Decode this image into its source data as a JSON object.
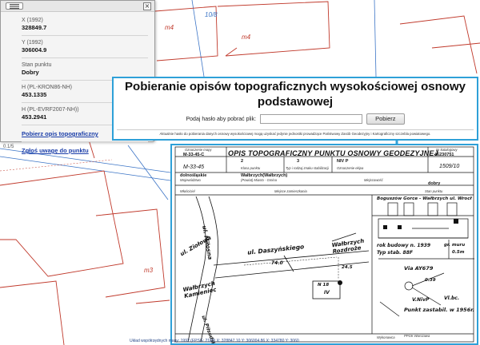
{
  "map": {
    "parcel_labels": [
      "m4",
      "m4",
      "m3",
      "10/8"
    ],
    "colors": {
      "parcel_red": "#c0392b",
      "road_blue": "#3b74c6",
      "accent_arrow": "#2ea0d8"
    }
  },
  "popup": {
    "collapse_icon": "list-icon",
    "close_label": "×",
    "fields": [
      {
        "label": "X (1992)",
        "value": "328849.7"
      },
      {
        "label": "Y (1992)",
        "value": "306004.9"
      },
      {
        "label": "Stan punktu",
        "value": "Dobry"
      },
      {
        "label": "H (PL-KRON86-NH)",
        "value": "453.1335"
      },
      {
        "label": "H (PL-EVRF2007-NH))",
        "value": "453.2941"
      }
    ],
    "links": {
      "download_description": "Pobierz opis topograficzny",
      "report_issue": "Zgłoś uwagę do punktu"
    },
    "scale_hint": "0.1/5"
  },
  "dialog": {
    "title": "Pobieranie opisów topograficznych wysokościowej osnowy podstawowej",
    "password_label": "Podaj hasło aby pobrać plik:",
    "password_value": "",
    "download_button": "Pobierz",
    "footnote": "Aktualnie hasło do pobierania danych osnowy wysokościowej mogą uzyskać jedynie jednostki prowadzące Państwowy Zasób Geodezyjny i Kartograficzny szczebla powiatowego."
  },
  "document": {
    "title": "OPIS TOPOGRAFICZNY PUNKTU OSNOWY GEODEZYJNEJ",
    "header": {
      "map_sheet_label": "Oznaczenie mapy",
      "map_sheet": "M-33-45-C",
      "map_sheet_2": "M-33-45",
      "class_label": "Klasa punktu",
      "class": "2",
      "stab_label": "Typ i rodzaj znaku stabilizacji",
      "stab": "3",
      "symbol_label": "Oznaczenie ekipa",
      "symbol": "NIV P",
      "catalog_label": "Nr katalogowy",
      "catalog": "46230751",
      "number": "1509/10",
      "voivodeship_label": "Województwo",
      "voivodeship": "dolnośląskie",
      "district_label": "(Powiat) Miasto - Gmina",
      "district": "Wałbrzych(Wałbrzych)",
      "locality_label": "Miejscowość",
      "state_label": "Stan punktu",
      "state": "dobry",
      "place_label": "Miejsce zamieszkania",
      "owner_label": "Właściciel"
    },
    "sketch": {
      "streets": [
        "ul. Ziołowa",
        "ul. Miłosna",
        "ul. Daszyńskiego",
        "Wałbrzych Kamieniec",
        "Wałbrzych Rozdroże",
        "ul. Piłsudskiego"
      ],
      "distances": [
        "74.0",
        "24.5"
      ],
      "point_box": [
        "N 18",
        "IV"
      ]
    },
    "elevation": {
      "caption": "Boguszów Gorce - Wałbrzych ul. Wrocł",
      "notes": [
        "rok budowy n. 1939",
        "gr. muru",
        "Typ stab. 88F",
        "0.5m"
      ],
      "numbers": [
        "0.39",
        "V.NivP",
        "Vl.bc.",
        "Punkt zastabil. w 1956r.",
        "Via AY679"
      ]
    },
    "footer": {
      "performer_label": "Wykonawca",
      "performer": "PPGK Warszawa"
    }
  },
  "coord_strip": "Układ współrzędnych mapy: 1992 (EPSG: 2180)  X: 328847.10  Y: 306004.86  X: 334780  Y: 3060"
}
